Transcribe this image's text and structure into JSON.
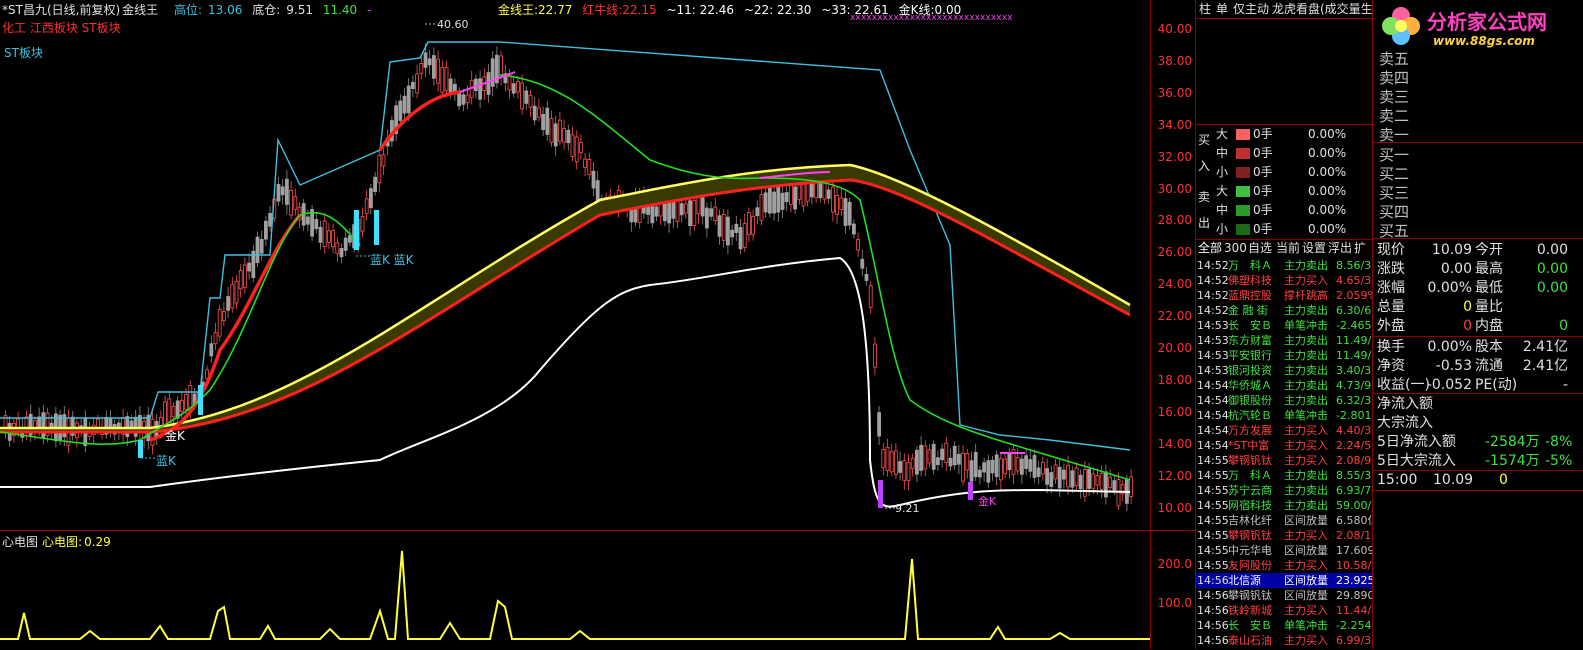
{
  "header": {
    "title": "*ST昌九(日线,前复权)",
    "indicator": "金线王",
    "hl_label": "高位:",
    "hl_value": "13.06",
    "bc_label": "底仓:",
    "bc_value": "9.51",
    "c_value": "11.40",
    "dash": "-",
    "gold_label": "金线王:",
    "gold_value": "22.77",
    "red_label": "红牛线:",
    "red_value": "22.15",
    "m11": "~11: 22.46",
    "m22": "~22: 22.30",
    "m33": "~33: 22.61",
    "gk_label": "金K线:",
    "gk_value": "0.00"
  },
  "blocks": {
    "line1": "化工 江西板块 ST板块",
    "line2": "ST板块"
  },
  "annotations": {
    "high": "40.60",
    "low": "9.21",
    "blue_k": "蓝K",
    "gold_k": "金K",
    "blue_k2": "蓝K 蓝K",
    "gold_k2": "金K"
  },
  "y_axis": [
    "40.00",
    "38.00",
    "36.00",
    "34.00",
    "32.00",
    "30.00",
    "28.00",
    "26.00",
    "24.00",
    "22.00",
    "20.00",
    "18.00",
    "16.00",
    "14.00",
    "12.00",
    "10.00"
  ],
  "osc": {
    "name": "心电图",
    "label": "心电图:",
    "value": "0.29",
    "ticks": [
      "200.0",
      "100.0"
    ]
  },
  "tabs": [
    "柱",
    "单",
    "仅主动",
    "龙虎看盘(成交量生"
  ],
  "flow": {
    "buy_side": "买入",
    "sell_side": "卖出",
    "rows": [
      {
        "size": "大",
        "vol": "0手",
        "pct": "0.00%",
        "color": "#ff6060"
      },
      {
        "size": "中",
        "vol": "0手",
        "pct": "0.00%",
        "color": "#c03030"
      },
      {
        "size": "小",
        "vol": "0手",
        "pct": "0.00%",
        "color": "#802020"
      },
      {
        "size": "大",
        "vol": "0手",
        "pct": "0.00%",
        "color": "#40c040"
      },
      {
        "size": "中",
        "vol": "0手",
        "pct": "0.00%",
        "color": "#2a9a2a"
      },
      {
        "size": "小",
        "vol": "0手",
        "pct": "0.00%",
        "color": "#1a6a1a"
      }
    ]
  },
  "list_tabs": [
    "全部",
    "300",
    "自选",
    "当前",
    "设置",
    "浮出",
    "扩"
  ],
  "trades": [
    {
      "t": "14:52",
      "n": "万　科Ａ",
      "a": "主力卖出",
      "v": "8.56/3",
      "nc": "#40e040",
      "ac": "#40e040",
      "vc": "#40e040"
    },
    {
      "t": "14:52",
      "n": "佛塑科技",
      "a": "主力买入",
      "v": "4.65/3",
      "nc": "#ff4040",
      "ac": "#ff4040",
      "vc": "#ff4040"
    },
    {
      "t": "14:52",
      "n": "蓝鼎控股",
      "a": "撑杆跳高",
      "v": "2.059%",
      "nc": "#ff4040",
      "ac": "#ff4040",
      "vc": "#ff4040"
    },
    {
      "t": "14:52",
      "n": "金 融 街",
      "a": "主力卖出",
      "v": "6.30/6",
      "nc": "#40e040",
      "ac": "#40e040",
      "vc": "#40e040"
    },
    {
      "t": "14:53",
      "n": "长　安Ｂ",
      "a": "单笔冲击",
      "v": "-2.465",
      "nc": "#40e040",
      "ac": "#40e040",
      "vc": "#40e040"
    },
    {
      "t": "14:53",
      "n": "东方财富",
      "a": "主力卖出",
      "v": "11.49/",
      "nc": "#40e040",
      "ac": "#40e040",
      "vc": "#40e040"
    },
    {
      "t": "14:53",
      "n": "平安银行",
      "a": "主力卖出",
      "v": "11.49/",
      "nc": "#40e040",
      "ac": "#40e040",
      "vc": "#40e040"
    },
    {
      "t": "14:53",
      "n": "银河投资",
      "a": "主力卖出",
      "v": "3.40/3",
      "nc": "#40e040",
      "ac": "#40e040",
      "vc": "#40e040"
    },
    {
      "t": "14:54",
      "n": "华侨城Ａ",
      "a": "主力卖出",
      "v": "4.73/9",
      "nc": "#40e040",
      "ac": "#40e040",
      "vc": "#40e040"
    },
    {
      "t": "14:54",
      "n": "御银股份",
      "a": "主力卖出",
      "v": "6.32/3",
      "nc": "#40e040",
      "ac": "#40e040",
      "vc": "#40e040"
    },
    {
      "t": "14:54",
      "n": "杭汽轮Ｂ",
      "a": "单笔冲击",
      "v": "-2.801",
      "nc": "#40e040",
      "ac": "#40e040",
      "vc": "#40e040"
    },
    {
      "t": "14:54",
      "n": "万方发展",
      "a": "主力买入",
      "v": "4.40/3",
      "nc": "#ff4040",
      "ac": "#ff4040",
      "vc": "#ff4040"
    },
    {
      "t": "14:54",
      "n": "*ST中富",
      "a": "主力买入",
      "v": "2.24/5",
      "nc": "#ff4040",
      "ac": "#ff4040",
      "vc": "#ff4040"
    },
    {
      "t": "14:55",
      "n": "攀钢钒钛",
      "a": "主力买入",
      "v": "2.08/9",
      "nc": "#ff4040",
      "ac": "#ff4040",
      "vc": "#ff4040"
    },
    {
      "t": "14:55",
      "n": "万　科Ａ",
      "a": "主力卖出",
      "v": "8.55/3",
      "nc": "#40e040",
      "ac": "#40e040",
      "vc": "#40e040"
    },
    {
      "t": "14:55",
      "n": "苏宁云商",
      "a": "主力卖出",
      "v": "6.93/7",
      "nc": "#40e040",
      "ac": "#40e040",
      "vc": "#40e040"
    },
    {
      "t": "14:55",
      "n": "网宿科技",
      "a": "主力卖出",
      "v": "59.00/",
      "nc": "#40e040",
      "ac": "#40e040",
      "vc": "#40e040"
    },
    {
      "t": "14:55",
      "n": "吉林化纤",
      "a": "区间放量",
      "v": "6.580亿",
      "nc": "#c0c0c0",
      "ac": "#c0c0c0",
      "vc": "#c0c0c0"
    },
    {
      "t": "14:55",
      "n": "攀钢钒钛",
      "a": "主力买入",
      "v": "2.08/1",
      "nc": "#ff4040",
      "ac": "#ff4040",
      "vc": "#ff4040"
    },
    {
      "t": "14:55",
      "n": "中元华电",
      "a": "区间放量",
      "v": "17.609",
      "nc": "#c0c0c0",
      "ac": "#c0c0c0",
      "vc": "#c0c0c0"
    },
    {
      "t": "14:55",
      "n": "友阿股份",
      "a": "主力买入",
      "v": "10.58/",
      "nc": "#ff4040",
      "ac": "#ff4040",
      "vc": "#ff4040"
    },
    {
      "t": "14:56",
      "n": "北信源",
      "a": "区间放量",
      "v": "23.925",
      "nc": "#ffffff",
      "ac": "#ffffff",
      "vc": "#ffffff",
      "sel": true
    },
    {
      "t": "14:56",
      "n": "攀钢钒钛",
      "a": "区间放量",
      "v": "29.890",
      "nc": "#c0c0c0",
      "ac": "#c0c0c0",
      "vc": "#c0c0c0"
    },
    {
      "t": "14:56",
      "n": "铁岭新城",
      "a": "主力买入",
      "v": "11.44/",
      "nc": "#ff4040",
      "ac": "#ff4040",
      "vc": "#ff4040"
    },
    {
      "t": "14:56",
      "n": "长　安Ｂ",
      "a": "单笔冲击",
      "v": "-2.254",
      "nc": "#40e040",
      "ac": "#40e040",
      "vc": "#40e040"
    },
    {
      "t": "14:56",
      "n": "泰山石油",
      "a": "主力买入",
      "v": "6.99/3",
      "nc": "#ff4040",
      "ac": "#ff4040",
      "vc": "#ff4040"
    }
  ],
  "logo": {
    "title": "分析家公式网",
    "url": "www.88gs.com"
  },
  "book": {
    "sells": [
      "卖五",
      "卖四",
      "卖三",
      "卖二",
      "卖一"
    ],
    "buys": [
      "买一",
      "买二",
      "买三",
      "买四",
      "买五"
    ]
  },
  "quote": [
    {
      "l1": "现价",
      "v1": "10.09",
      "l2": "今开",
      "v2": "0.00"
    },
    {
      "l1": "涨跌",
      "v1": "0.00",
      "l2": "最高",
      "v2": "0.00"
    },
    {
      "l1": "涨幅",
      "v1": "0.00%",
      "l2": "最低",
      "v2": "0.00"
    },
    {
      "l1": "总量",
      "v1": "0",
      "l2": "量比",
      "v2": ""
    },
    {
      "l1": "外盘",
      "v1": "0",
      "l2": "内盘",
      "v2": "0"
    },
    {
      "l1": "换手",
      "v1": "0.00%",
      "l2": "股本",
      "v2": "2.41亿"
    },
    {
      "l1": "净资",
      "v1": "-0.53",
      "l2": "流通",
      "v2": "2.41亿"
    },
    {
      "l1": "收益(一)",
      "v1": "-0.052",
      "l2": "PE(动)",
      "v2": "-"
    }
  ],
  "netflow": {
    "l1": "净流入额",
    "l2": "大宗流入",
    "r1_label": "5日净流入额",
    "r1_value": "-2584万",
    "r1_pct": "-8%",
    "r2_label": "5日大宗流入",
    "r2_value": "-1574万",
    "r2_pct": "-5%",
    "tick_time": "15:00",
    "tick_price": "10.09",
    "tick_vol": "0"
  }
}
